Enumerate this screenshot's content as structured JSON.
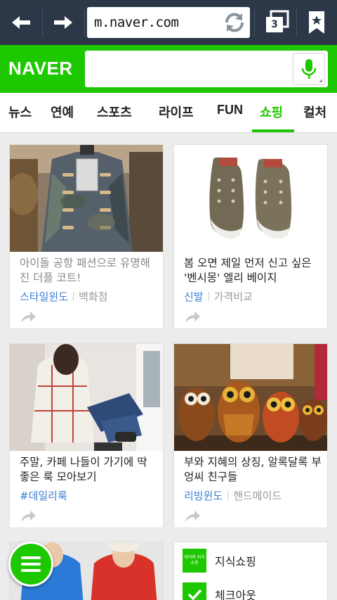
{
  "browser": {
    "url": "m.naver.com",
    "tab_count": "3"
  },
  "header": {
    "logo": "NAVER",
    "search_placeholder": ""
  },
  "categories": [
    "뉴스",
    "연예",
    "스포츠",
    "라이프",
    "FUN",
    "쇼핑",
    "컬처"
  ],
  "active_category": "쇼핑",
  "cards": [
    {
      "title": "아이돌 공항 패션으로 유명해진 더플 코트!",
      "category": "스타일윈도",
      "sub": "백화점",
      "visited": true
    },
    {
      "title": "봄 오면 제일 먼저 신고 싶은 '벤시몽' 엘리 베이지",
      "category": "신발",
      "sub": "가격비교",
      "visited": false
    },
    {
      "title": "주말, 카페 나들이 가기에 딱 좋은 룩 모아보기",
      "category": "#데일리룩",
      "sub": "",
      "visited": false
    },
    {
      "title": "부와 지혜의 상징, 알록달록 부엉씨 친구들",
      "category": "리빙윈도",
      "sub": "핸드메이드",
      "visited": false
    }
  ],
  "shop_list": [
    {
      "icon_text": "네이버 지식쇼핑",
      "label": "지식쇼핑"
    },
    {
      "icon_text": "",
      "label": "체크아웃"
    }
  ],
  "colors": {
    "naver_green": "#1ec800",
    "toolbar": "#2c3848",
    "link_blue": "#3d7fd4"
  },
  "icons": [
    "back-arrow-icon",
    "forward-arrow-icon",
    "refresh-icon",
    "tabs-icon",
    "bookmark-icon",
    "microphone-icon",
    "share-icon",
    "menu-icon"
  ]
}
